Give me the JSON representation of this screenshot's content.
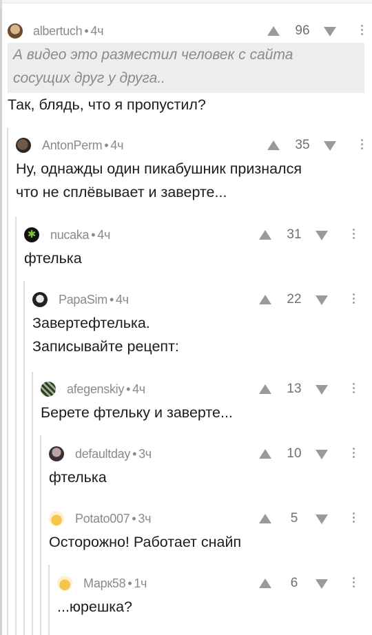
{
  "comments": [
    {
      "user": "albertuch",
      "time": "4ч",
      "score": "96",
      "quote": [
        "А видео это разместил человек с сайта",
        "сосущих друг у друга.."
      ],
      "lines": [
        "Так, блядь, что я пропустил?"
      ],
      "avatar": "face-avatar"
    },
    {
      "user": "AntonPerm",
      "time": "4ч",
      "score": "35",
      "lines": [
        "Ну, однажды один пикабушник признался",
        "что не сплёвывает и заверте..."
      ],
      "avatar": "face-avatar"
    },
    {
      "user": "nucaka",
      "time": "4ч",
      "score": "31",
      "lines": [
        "фтелька"
      ],
      "avatar": "leaf-avatar"
    },
    {
      "user": "PapaSim",
      "time": "4ч",
      "score": "22",
      "lines": [
        "Завертефтелька.",
        "Записывайте рецепт:"
      ],
      "avatar": "face-avatar"
    },
    {
      "user": "afegenskiy",
      "time": "4ч",
      "score": "13",
      "lines": [
        "Берете фтельку и заверте..."
      ],
      "avatar": "pattern-avatar"
    },
    {
      "user": "defaultday",
      "time": "3ч",
      "score": "10",
      "lines": [
        "фтелька"
      ],
      "avatar": "face-avatar"
    },
    {
      "user": "Potato007",
      "time": "3ч",
      "score": "5",
      "lines": [
        "Осторожно! Работает снайп"
      ],
      "avatar": "cake-avatar"
    },
    {
      "user": "Марк58",
      "time": "1ч",
      "score": "6",
      "lines": [
        "...юрешка?"
      ],
      "avatar": "cake-avatar"
    }
  ],
  "icons": {
    "upvote": "arrow-up-icon",
    "downvote": "arrow-down-icon",
    "more": "kebab-menu-icon"
  },
  "colors": {
    "meta": "#8a8a8a",
    "quote_bg": "#ededed",
    "thread_line": "#dedede"
  }
}
